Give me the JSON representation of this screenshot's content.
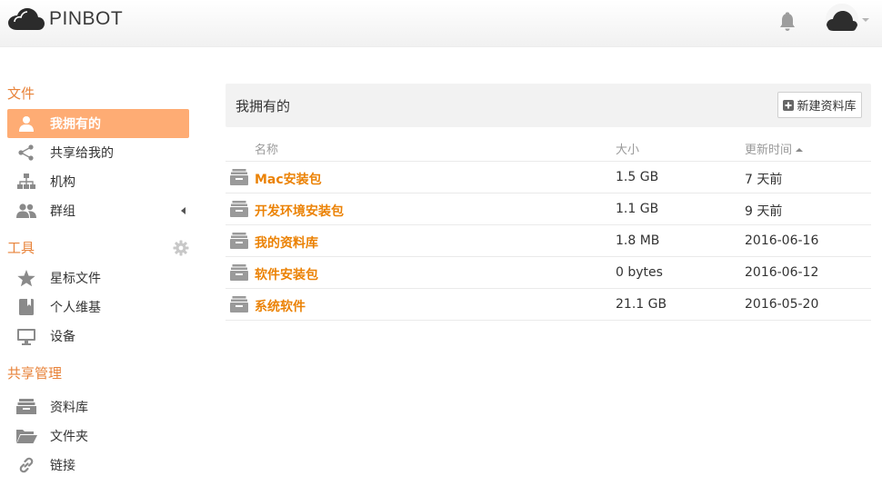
{
  "header": {
    "logo_text": "PINBOT",
    "logo_icon": "cloud-icon",
    "notification_icon": "bell-icon",
    "avatar_icon": "cloud-avatar"
  },
  "sidebar": {
    "sections": [
      {
        "title": "文件",
        "items": [
          {
            "label": "我拥有的",
            "icon": "user-icon",
            "active": true
          },
          {
            "label": "共享给我的",
            "icon": "share-icon"
          },
          {
            "label": "机构",
            "icon": "org-icon"
          },
          {
            "label": "群组",
            "icon": "group-icon",
            "expandable": true
          }
        ]
      },
      {
        "title": "工具",
        "settings_icon": "gear-icon",
        "items": [
          {
            "label": "星标文件",
            "icon": "star-icon"
          },
          {
            "label": "个人维基",
            "icon": "book-icon"
          },
          {
            "label": "设备",
            "icon": "monitor-icon"
          }
        ]
      },
      {
        "title": "共享管理",
        "items": [
          {
            "label": "资料库",
            "icon": "library-icon"
          },
          {
            "label": "文件夹",
            "icon": "folder-icon"
          },
          {
            "label": "链接",
            "icon": "link-icon"
          }
        ]
      }
    ]
  },
  "main": {
    "title": "我拥有的",
    "new_library_label": "新建资料库",
    "columns": {
      "name": "名称",
      "size": "大小",
      "updated": "更新时间"
    },
    "sort": {
      "column": "updated",
      "direction": "asc"
    },
    "rows": [
      {
        "name": "Mac安装包",
        "size": "1.5 GB",
        "updated": "7 天前"
      },
      {
        "name": "开发环境安装包",
        "size": "1.1 GB",
        "updated": "9 天前"
      },
      {
        "name": "我的资料库",
        "size": "1.8 MB",
        "updated": "2016-06-16"
      },
      {
        "name": "软件安装包",
        "size": "0 bytes",
        "updated": "2016-06-12"
      },
      {
        "name": "系统软件",
        "size": "21.1 GB",
        "updated": "2016-05-20"
      }
    ]
  },
  "colors": {
    "accent": "#e8833a",
    "active_item_bg": "#feac74",
    "link": "#eb8205",
    "icon_gray": "#8a8a8a"
  }
}
